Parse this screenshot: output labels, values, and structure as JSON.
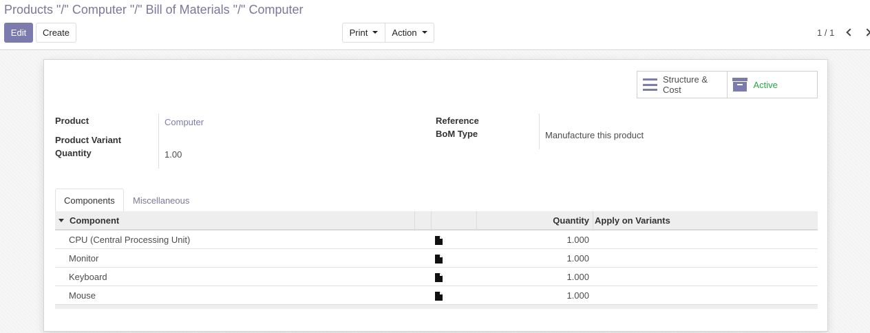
{
  "breadcrumb": "Products \"/\" Computer \"/\" Bill of Materials \"/\" Computer",
  "toolbar": {
    "edit_label": "Edit",
    "create_label": "Create",
    "print_label": "Print",
    "action_label": "Action"
  },
  "pager": {
    "value": "1 / 1"
  },
  "stat_buttons": {
    "structure_label": "Structure & Cost",
    "active_label": "Active"
  },
  "fields": {
    "product_label": "Product",
    "product_value": "Computer",
    "product_variant_label": "Product Variant",
    "quantity_label": "Quantity",
    "quantity_value": "1.00",
    "reference_label": "Reference",
    "bom_type_label": "BoM Type",
    "bom_type_value": "Manufacture this product"
  },
  "tabs": [
    {
      "label": "Components",
      "active": true
    },
    {
      "label": "Miscellaneous",
      "active": false
    }
  ],
  "table": {
    "headers": {
      "component": "Component",
      "quantity": "Quantity",
      "variants": "Apply on Variants"
    },
    "rows": [
      {
        "component": "CPU (Central Processing Unit)",
        "quantity": "1.000"
      },
      {
        "component": "Monitor",
        "quantity": "1.000"
      },
      {
        "component": "Keyboard",
        "quantity": "1.000"
      },
      {
        "component": "Mouse",
        "quantity": "1.000"
      }
    ]
  },
  "icons": {
    "structure": "bars-icon",
    "active": "archive-icon",
    "row": "file-icon"
  },
  "colors": {
    "accent": "#7c7bad",
    "active_green": "#28a745",
    "breadcrumb": "#7a7898"
  }
}
